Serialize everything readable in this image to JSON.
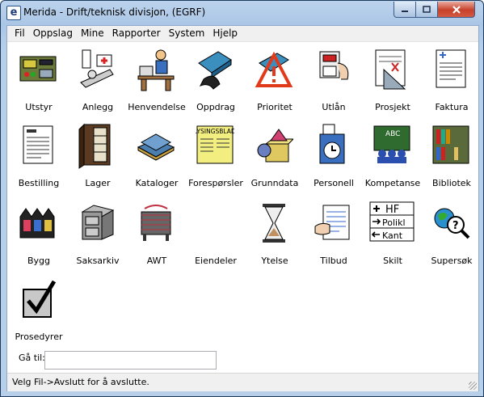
{
  "window": {
    "title": "Merida  - Drift/teknisk divisjon, (EGRF)",
    "app_icon_letter": "e"
  },
  "menu": [
    {
      "label": "Fil"
    },
    {
      "label": "Oppslag"
    },
    {
      "label": "Mine"
    },
    {
      "label": "Rapporter"
    },
    {
      "label": "System"
    },
    {
      "label": "Hjelp"
    }
  ],
  "tiles": [
    {
      "label": "Utstyr",
      "icon": "equipment-icon"
    },
    {
      "label": "Anlegg",
      "icon": "facility-icon"
    },
    {
      "label": "Henvendelse",
      "icon": "inquiry-icon"
    },
    {
      "label": "Oppdrag",
      "icon": "assignment-icon"
    },
    {
      "label": "Prioritet",
      "icon": "priority-icon"
    },
    {
      "label": "Utlån",
      "icon": "loan-icon"
    },
    {
      "label": "Prosjekt",
      "icon": "project-icon"
    },
    {
      "label": "Faktura",
      "icon": "invoice-icon"
    },
    {
      "label": "Bestilling",
      "icon": "order-icon"
    },
    {
      "label": "Lager",
      "icon": "warehouse-icon"
    },
    {
      "label": "Kataloger",
      "icon": "catalog-icon"
    },
    {
      "label": "Forespørsler",
      "icon": "request-icon"
    },
    {
      "label": "Grunndata",
      "icon": "basedata-icon"
    },
    {
      "label": "Personell",
      "icon": "personnel-icon"
    },
    {
      "label": "Kompetanse",
      "icon": "competence-icon"
    },
    {
      "label": "Bibliotek",
      "icon": "library-icon"
    },
    {
      "label": "Bygg",
      "icon": "building-icon"
    },
    {
      "label": "Saksarkiv",
      "icon": "archive-icon"
    },
    {
      "label": "AWT",
      "icon": "awt-icon"
    },
    {
      "label": "Eiendeler",
      "icon": "assets-icon"
    },
    {
      "label": "Ytelse",
      "icon": "hourglass-icon"
    },
    {
      "label": "Tilbud",
      "icon": "offer-icon"
    },
    {
      "label": "Skilt",
      "icon": "sign-icon"
    },
    {
      "label": "Supersøk",
      "icon": "supersearch-icon"
    },
    {
      "label": "Prosedyrer",
      "icon": "checkbox-icon"
    }
  ],
  "lysingsblad": "LYSINGSBLAD",
  "abc": "ABC",
  "skilt_lines": [
    "HF",
    "Polikl",
    "Kant"
  ],
  "goto": {
    "label": "Gå til:",
    "value": ""
  },
  "status": {
    "text": "Velg Fil->Avslutt for å avslutte."
  },
  "colors": {
    "titlebar": "#aac6e6",
    "close": "#c8412b",
    "client": "#ffffff"
  }
}
